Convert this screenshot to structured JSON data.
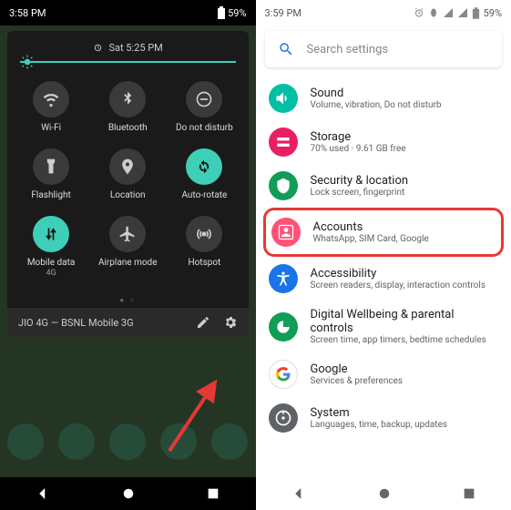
{
  "left": {
    "status": {
      "time": "3:58 PM",
      "battery": "59%"
    },
    "clock": {
      "day_time": "Sat 5:25 PM"
    },
    "tiles": [
      {
        "name": "wifi",
        "label": "Wi-Fi",
        "sub": "",
        "on": false
      },
      {
        "name": "bluetooth",
        "label": "Bluetooth",
        "sub": "",
        "on": false
      },
      {
        "name": "dnd",
        "label": "Do not disturb",
        "sub": "",
        "on": false
      },
      {
        "name": "flashlight",
        "label": "Flashlight",
        "sub": "",
        "on": false
      },
      {
        "name": "location",
        "label": "Location",
        "sub": "",
        "on": false
      },
      {
        "name": "autorotate",
        "label": "Auto-rotate",
        "sub": "",
        "on": true
      },
      {
        "name": "mobiledata",
        "label": "Mobile data",
        "sub": "4G",
        "on": true
      },
      {
        "name": "airplane",
        "label": "Airplane mode",
        "sub": "",
        "on": false
      },
      {
        "name": "hotspot",
        "label": "Hotspot",
        "sub": "",
        "on": false
      }
    ],
    "carrier": "JIO 4G — BSNL Mobile 3G"
  },
  "right": {
    "status": {
      "time": "3:59 PM",
      "battery": "59%"
    },
    "search_placeholder": "Search settings",
    "items": [
      {
        "icon": "sound",
        "color": "#00bfa5",
        "title": "Sound",
        "sub": "Volume, vibration, Do not disturb",
        "hl": false
      },
      {
        "icon": "storage",
        "color": "#e91e63",
        "title": "Storage",
        "sub": "70% used · 9.61 GB free",
        "hl": false
      },
      {
        "icon": "security",
        "color": "#0f9d58",
        "title": "Security & location",
        "sub": "Lock screen, fingerprint",
        "hl": false
      },
      {
        "icon": "accounts",
        "color": "#ff5277",
        "title": "Accounts",
        "sub": "WhatsApp, SIM Card, Google",
        "hl": true
      },
      {
        "icon": "accessibility",
        "color": "#1a73e8",
        "title": "Accessibility",
        "sub": "Screen readers, display, interaction controls",
        "hl": false
      },
      {
        "icon": "wellbeing",
        "color": "#0f9d58",
        "title": "Digital Wellbeing & parental controls",
        "sub": "Screen time, app timers, bedtime schedules",
        "hl": false
      },
      {
        "icon": "google",
        "color": "#fff",
        "title": "Google",
        "sub": "Services & preferences",
        "hl": false
      },
      {
        "icon": "system",
        "color": "#5f6368",
        "title": "System",
        "sub": "Languages, time, backup, updates",
        "hl": false
      }
    ]
  }
}
